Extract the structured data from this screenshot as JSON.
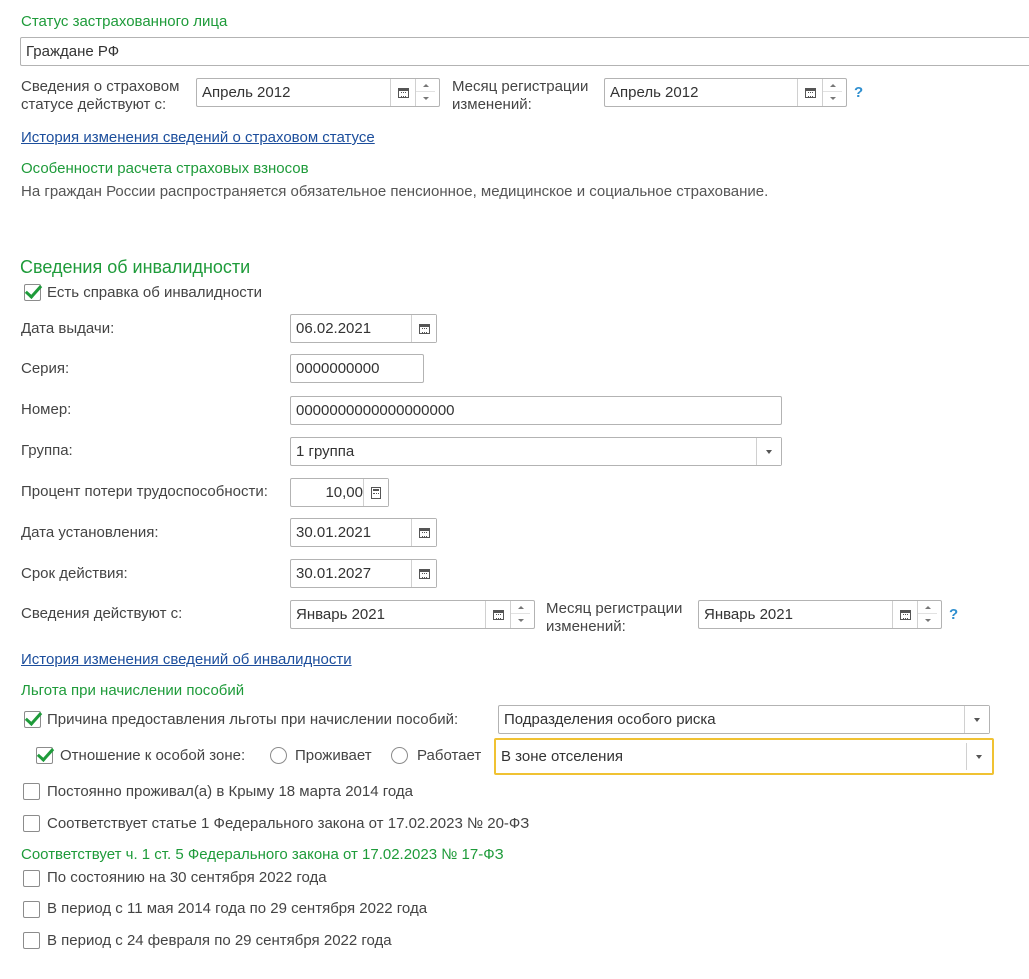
{
  "insured": {
    "status_title": "Статус застрахованного лица",
    "status_value": "Граждане РФ",
    "status_valid_label_1": "Сведения о страховом",
    "status_valid_label_2": "статусе действуют с:",
    "status_valid_value": "Апрель 2012",
    "reg_month_label_1": "Месяц регистрации",
    "reg_month_label_2": "изменений:",
    "reg_month_value": "Апрель 2012",
    "help": "?",
    "history_link": "История изменения сведений о страховом статусе",
    "calc_title": "Особенности расчета страховых взносов",
    "calc_text": "На граждан России распространяется обязательное пенсионное, медицинское и социальное страхование."
  },
  "disability": {
    "title": "Сведения об инвалидности",
    "has_certificate_label": "Есть справка об инвалидности",
    "has_certificate": true,
    "issue_date_label": "Дата выдачи:",
    "issue_date": "06.02.2021",
    "series_label": "Серия:",
    "series": "0000000000",
    "number_label": "Номер:",
    "number": "0000000000000000000",
    "group_label": "Группа:",
    "group": "1 группа",
    "loss_label": "Процент потери трудоспособности:",
    "loss": "10,00",
    "established_label": "Дата установления:",
    "established": "30.01.2021",
    "validity_label": "Срок действия:",
    "validity": "30.01.2027",
    "valid_from_label": "Сведения действуют с:",
    "valid_from": "Январь 2021",
    "reg_month_label_1": "Месяц регистрации",
    "reg_month_label_2": "изменений:",
    "reg_month": "Январь 2021",
    "help": "?",
    "history_link": "История изменения сведений об инвалидности"
  },
  "benefits": {
    "title": "Льгота при начислении пособий",
    "reason_label": "Причина предоставления льготы при начислении пособий:",
    "reason_checked": true,
    "reason_value": "Подразделения особого риска",
    "zone_label": "Отношение к особой зоне:",
    "zone_checked": true,
    "radio_lives": "Проживает",
    "radio_works": "Работает",
    "zone_value": "В зоне отселения",
    "crimea_label": "Постоянно проживал(а) в Крыму 18 марта 2014 года",
    "law20_label": "Соответствует статье 1 Федерального закона от 17.02.2023 № 20-ФЗ",
    "law17_title": "Соответствует ч. 1 ст. 5 Федерального закона от 17.02.2023 № 17-ФЗ",
    "opt1": "По состоянию на 30 сентября 2022 года",
    "opt2": "В период с 11 мая 2014 года по 29 сентября 2022 года",
    "opt3": "В период с 24 февраля по 29 сентября 2022 года"
  }
}
